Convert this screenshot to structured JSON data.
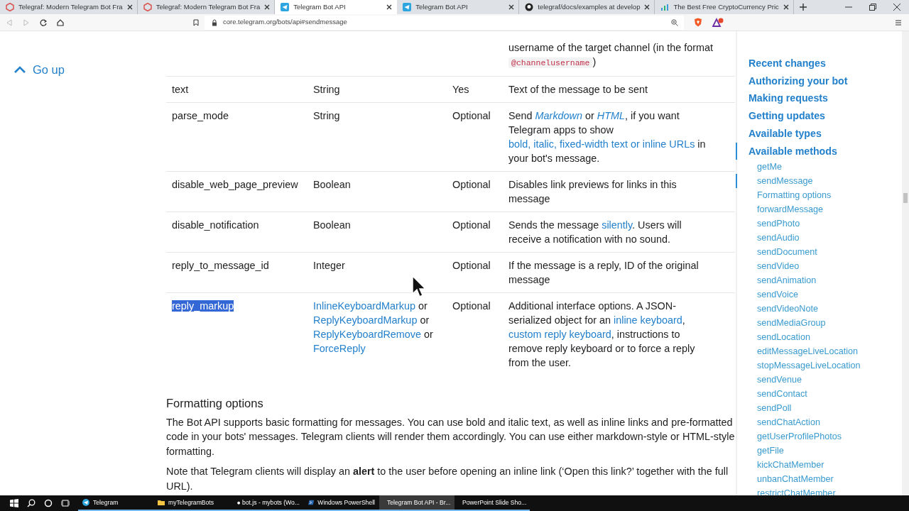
{
  "browser_tabs": [
    {
      "title": "Telegraf: Modern Telegram Bot Fra",
      "kind": "telegraf",
      "selected": false
    },
    {
      "title": "Telegraf: Modern Telegram Bot Fra",
      "kind": "telegraf",
      "selected": false
    },
    {
      "title": "Telegram Bot API",
      "kind": "telegram",
      "selected": true
    },
    {
      "title": "Telegram Bot API",
      "kind": "telegram",
      "selected": false
    },
    {
      "title": "telegraf/docs/examples at develop",
      "kind": "github",
      "selected": false
    },
    {
      "title": "The Best Free CryptoCurrency Pric",
      "kind": "chart",
      "selected": false
    }
  ],
  "address_bar": {
    "url": "core.telegram.org/bots/api#sendmessage"
  },
  "go_up": {
    "label": "Go up"
  },
  "parameters_table": {
    "rows": [
      {
        "parameter": "",
        "type": [],
        "required": "",
        "description": [
          {
            "kind": "text",
            "text": "username of the target channel (in the format "
          },
          {
            "kind": "code",
            "text": "@channelusername"
          },
          {
            "kind": "text",
            "text": ")"
          }
        ]
      },
      {
        "parameter": "text",
        "type": [
          {
            "kind": "text",
            "text": "String"
          }
        ],
        "required": "Yes",
        "description": [
          {
            "kind": "text",
            "text": "Text of the message to be sent"
          }
        ],
        "highlighted": false
      },
      {
        "parameter": "parse_mode",
        "type": [
          {
            "kind": "text",
            "text": "String"
          }
        ],
        "required": "Optional",
        "description": [
          {
            "kind": "text",
            "text": "Send "
          },
          {
            "kind": "italic-link",
            "text": "Markdown"
          },
          {
            "kind": "text",
            "text": " or "
          },
          {
            "kind": "italic-link",
            "text": "HTML"
          },
          {
            "kind": "text",
            "text": ", if you want Telegram apps to show "
          },
          {
            "kind": "link",
            "text": "bold, italic, fixed-width text or inline URLs"
          },
          {
            "kind": "text",
            "text": " in your bot's message."
          }
        ],
        "highlighted": false
      },
      {
        "parameter": "disable_web_page_preview",
        "type": [
          {
            "kind": "text",
            "text": "Boolean"
          }
        ],
        "required": "Optional",
        "description": [
          {
            "kind": "text",
            "text": "Disables link previews for links in this message"
          }
        ],
        "highlighted": false
      },
      {
        "parameter": "disable_notification",
        "type": [
          {
            "kind": "text",
            "text": "Boolean"
          }
        ],
        "required": "Optional",
        "description": [
          {
            "kind": "text",
            "text": "Sends the message "
          },
          {
            "kind": "link",
            "text": "silently"
          },
          {
            "kind": "text",
            "text": ". Users will receive a notification with no sound."
          }
        ],
        "highlighted": false
      },
      {
        "parameter": "reply_to_message_id",
        "type": [
          {
            "kind": "text",
            "text": "Integer"
          }
        ],
        "required": "Optional",
        "description": [
          {
            "kind": "text",
            "text": "If the message is a reply, ID of the original message"
          }
        ],
        "highlighted": false
      },
      {
        "parameter": "reply_markup",
        "type": [
          {
            "kind": "link",
            "text": "InlineKeyboardMarkup"
          },
          {
            "kind": "text",
            "text": " or "
          },
          {
            "kind": "link",
            "text": "ReplyKeyboardMarkup"
          },
          {
            "kind": "text",
            "text": " or "
          },
          {
            "kind": "link",
            "text": "ReplyKeyboardRemove"
          },
          {
            "kind": "text",
            "text": " or "
          },
          {
            "kind": "link",
            "text": "ForceReply"
          }
        ],
        "required": "Optional",
        "description": [
          {
            "kind": "text",
            "text": "Additional interface options. A JSON-serialized object for an "
          },
          {
            "kind": "link",
            "text": "inline keyboard"
          },
          {
            "kind": "text",
            "text": ", "
          },
          {
            "kind": "link",
            "text": "custom reply keyboard"
          },
          {
            "kind": "text",
            "text": ", instructions to remove reply keyboard or to force a reply from the user."
          }
        ],
        "highlighted": true
      }
    ]
  },
  "section": {
    "heading": "Formatting options",
    "paragraphs": [
      "The Bot API supports basic formatting for messages. You can use bold and italic text, as well as inline links and pre-formatted code in your bots' messages. Telegram clients will render them accordingly. You can use either markdown-style or HTML-style formatting.",
      "Note that Telegram clients will display an **alert** to the user before opening an inline link (‘Open this link?’ together with the full URL)."
    ]
  },
  "sidebar": {
    "items": [
      {
        "label": "Recent changes",
        "selected": false
      },
      {
        "label": "Authorizing your bot",
        "selected": false
      },
      {
        "label": "Making requests",
        "selected": false
      },
      {
        "label": "Getting updates",
        "selected": false
      },
      {
        "label": "Available types",
        "selected": false
      },
      {
        "label": "Available methods",
        "selected": true,
        "children": [
          {
            "label": "getMe",
            "selected": false
          },
          {
            "label": "sendMessage",
            "selected": true
          },
          {
            "label": "Formatting options",
            "selected": false
          },
          {
            "label": "forwardMessage",
            "selected": false
          },
          {
            "label": "sendPhoto",
            "selected": false
          },
          {
            "label": "sendAudio",
            "selected": false
          },
          {
            "label": "sendDocument",
            "selected": false
          },
          {
            "label": "sendVideo",
            "selected": false
          },
          {
            "label": "sendAnimation",
            "selected": false
          },
          {
            "label": "sendVoice",
            "selected": false
          },
          {
            "label": "sendVideoNote",
            "selected": false
          },
          {
            "label": "sendMediaGroup",
            "selected": false
          },
          {
            "label": "sendLocation",
            "selected": false
          },
          {
            "label": "editMessageLiveLocation",
            "selected": false
          },
          {
            "label": "stopMessageLiveLocation",
            "selected": false
          },
          {
            "label": "sendVenue",
            "selected": false
          },
          {
            "label": "sendContact",
            "selected": false
          },
          {
            "label": "sendPoll",
            "selected": false
          },
          {
            "label": "sendChatAction",
            "selected": false
          },
          {
            "label": "getUserProfilePhotos",
            "selected": false
          },
          {
            "label": "getFile",
            "selected": false
          },
          {
            "label": "kickChatMember",
            "selected": false
          },
          {
            "label": "unbanChatMember",
            "selected": false
          },
          {
            "label": "restrictChatMember",
            "selected": false
          }
        ]
      }
    ]
  },
  "taskbar": {
    "items": [
      {
        "label": "Telegram",
        "kind": "telegram",
        "selected": false
      },
      {
        "label": "myTelegramBots",
        "kind": "folder",
        "selected": false
      },
      {
        "label": "● bot.js - mybots (Wo...",
        "kind": "vscode",
        "selected": false
      },
      {
        "label": "Windows PowerShell",
        "kind": "powershell",
        "selected": false
      },
      {
        "label": "Telegram Bot API - Br...",
        "kind": "brave",
        "selected": true
      },
      {
        "label": "PowerPoint Slide Sho...",
        "kind": "powerpoint",
        "selected": false
      }
    ]
  }
}
